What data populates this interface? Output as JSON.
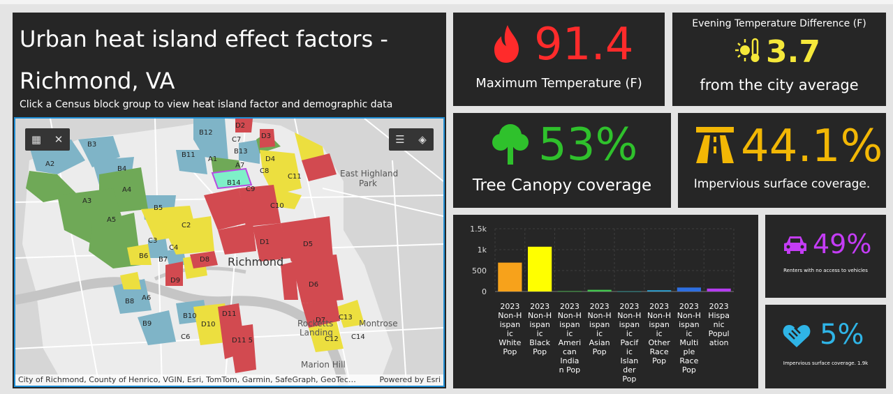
{
  "header": {
    "title_line1": "Urban heat island effect factors -",
    "title_line2": "Richmond, VA",
    "subtitle": "Click a Census block group to view heat island factor and demographic data"
  },
  "map": {
    "tools_left": [
      "select-icon",
      "close-icon"
    ],
    "tools_right": [
      "legend-icon",
      "layers-icon"
    ],
    "attribution": "City of Richmond, County of Henrico, VGIN, Esri, TomTom, Garmin, SafeGraph, GeoTec…",
    "powered_by": "Powered by Esri",
    "places": {
      "richmond": "Richmond",
      "east_highland_park_1": "East Highland",
      "east_highland_park_2": "Park",
      "rocketts_landing_1": "Rocketts",
      "rocketts_landing_2": "Landing",
      "montrose": "Montrose",
      "marion_hill": "Marion Hill"
    },
    "labels": [
      "B12",
      "D2",
      "D3",
      "C7",
      "B13",
      "B11",
      "A1",
      "A7",
      "C8",
      "D4",
      "B3",
      "A2",
      "B4",
      "B14",
      "C11",
      "C9",
      "A4",
      "A3",
      "C10",
      "B5",
      "A5",
      "C2",
      "D1",
      "D5",
      "C3",
      "C4",
      "B6",
      "B7",
      "D8",
      "D9",
      "D6",
      "B8",
      "A6",
      "B10",
      "D10",
      "D11",
      "D7",
      "C13",
      "B9",
      "C6",
      "D11s",
      "C12",
      "C14"
    ],
    "label_text": {
      "D11s": "D11 5"
    },
    "colors": {
      "red": "#d24a50",
      "yellow": "#ecdf3f",
      "blue": "#7fb4c7",
      "green": "#6fa957",
      "highlight": "#7ef0c8"
    }
  },
  "stats": {
    "max_temp": {
      "value": "91.4",
      "label": "Maximum Temperature (F)",
      "color": "#ff2b2b",
      "icon": "flame-icon"
    },
    "evening": {
      "title": "Evening Temperature Difference (F)",
      "value": "3.7",
      "label": "from the city average",
      "color": "#f5e83a",
      "icon": "thermometer-sun-icon"
    },
    "tree": {
      "value": "53%",
      "label": "Tree Canopy coverage",
      "color": "#2fc12c",
      "icon": "tree-icon"
    },
    "impervious": {
      "value": "44.1%",
      "label": "Impervious surface coverage.",
      "color": "#f2b705",
      "icon": "highway-icon"
    },
    "renters": {
      "value": "49%",
      "label": "Renters with no access to vehicles",
      "color": "#c43cf5",
      "icon": "car-icon"
    },
    "impervious2": {
      "value": "5%",
      "label": "Impervious surface coverage. 1.9k",
      "color": "#2fb4e6",
      "icon": "heart-hands-icon"
    }
  },
  "chart_data": {
    "type": "bar",
    "categories": [
      "2023 Non-Hispanic White Pop",
      "2023 Non-Hispanic Black Pop",
      "2023 Non-Hispanic American Indian Pop",
      "2023 Non-Hispanic Asian Pop",
      "2023 Non-Hispanic Pacific Islander Pop",
      "2023 Non-Hispanic Other Race Pop",
      "2023 Non-Hispanic Multiple Race Pop",
      "2023 Hispanic Population"
    ],
    "category_lines": [
      [
        "2023",
        "Non-H",
        "ispan",
        "ic",
        "White",
        "Pop"
      ],
      [
        "2023",
        "Non-H",
        "ispan",
        "ic",
        "Black",
        "Pop"
      ],
      [
        "2023",
        "Non-H",
        "ispan",
        "ic",
        "Ameri",
        "can",
        "India",
        "n Pop"
      ],
      [
        "2023",
        "Non-H",
        "ispan",
        "ic",
        "Asian",
        "Pop"
      ],
      [
        "2023",
        "Non-H",
        "ispan",
        "ic",
        "Pacif",
        "ic",
        "Islan",
        "der",
        "Pop"
      ],
      [
        "2023",
        "Non-H",
        "ispan",
        "ic",
        "Other",
        "Race",
        "Pop"
      ],
      [
        "2023",
        "Non-H",
        "ispan",
        "ic",
        "Multi",
        "ple",
        "Race",
        "Pop"
      ],
      [
        "2023",
        "Hispa",
        "nic",
        "Popul",
        "ation"
      ]
    ],
    "values": [
      690,
      1070,
      10,
      40,
      5,
      30,
      95,
      70
    ],
    "colors": [
      "#f7a21b",
      "#ffff00",
      "#4caf50",
      "#43c74f",
      "#2e8b8b",
      "#2ba3d6",
      "#2e6fe0",
      "#b53cf0"
    ],
    "ylim": [
      0,
      1500
    ],
    "yticks": [
      "0",
      "500",
      "1k",
      "1.5k"
    ],
    "ytick_values": [
      0,
      500,
      1000,
      1500
    ],
    "grid": true
  }
}
